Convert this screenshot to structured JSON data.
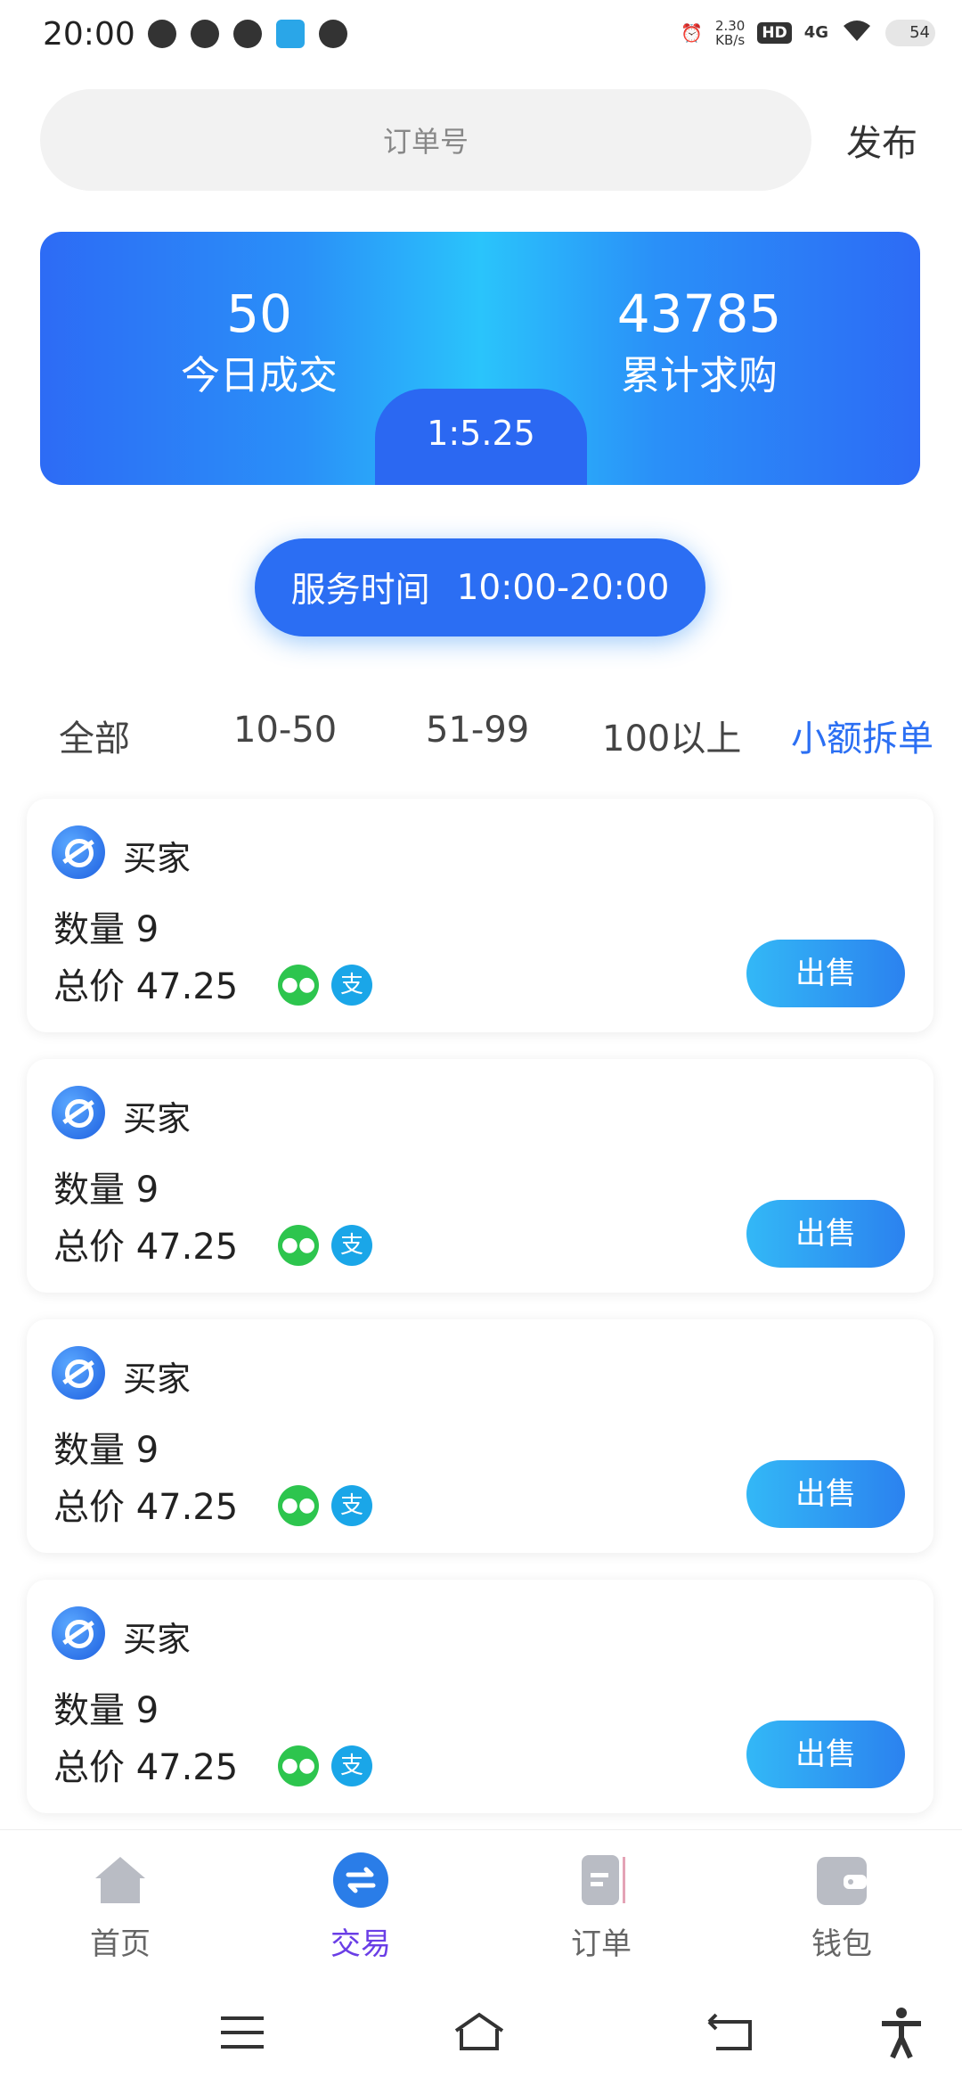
{
  "status_bar": {
    "time": "20:00",
    "speed_value": "2.30",
    "speed_unit": "KB/s",
    "hd": "HD",
    "network": "4G",
    "battery": "54"
  },
  "search": {
    "placeholder": "订单号"
  },
  "header": {
    "publish_label": "发布"
  },
  "banner": {
    "today_value": "50",
    "today_label": "今日成交",
    "total_value": "43785",
    "total_label": "累计求购",
    "rate": "1:5.25"
  },
  "service": {
    "label": "服务时间",
    "hours": "10:00-20:00"
  },
  "filters": [
    {
      "label": "全部"
    },
    {
      "label": "10-50"
    },
    {
      "label": "51-99"
    },
    {
      "label": "100以上"
    },
    {
      "label": "小额拆单"
    }
  ],
  "orders": [
    {
      "buyer": "买家",
      "qty_label": "数量",
      "qty": "9",
      "total_label": "总价",
      "total": "47.25",
      "sell_label": "出售"
    },
    {
      "buyer": "买家",
      "qty_label": "数量",
      "qty": "9",
      "total_label": "总价",
      "total": "47.25",
      "sell_label": "出售"
    },
    {
      "buyer": "买家",
      "qty_label": "数量",
      "qty": "9",
      "total_label": "总价",
      "total": "47.25",
      "sell_label": "出售"
    },
    {
      "buyer": "买家",
      "qty_label": "数量",
      "qty": "9",
      "total_label": "总价",
      "total": "47.25",
      "sell_label": "出售"
    }
  ],
  "pay_icons": {
    "alipay_glyph": "支"
  },
  "nav": [
    {
      "label": "首页",
      "icon": "home-icon"
    },
    {
      "label": "交易",
      "icon": "exchange-icon"
    },
    {
      "label": "订单",
      "icon": "order-icon"
    },
    {
      "label": "钱包",
      "icon": "wallet-icon"
    }
  ],
  "colors": {
    "accent": "#2b6ff3",
    "active_nav": "#6a3ee6",
    "wechat": "#2dc54e",
    "alipay": "#1aa6e8"
  }
}
